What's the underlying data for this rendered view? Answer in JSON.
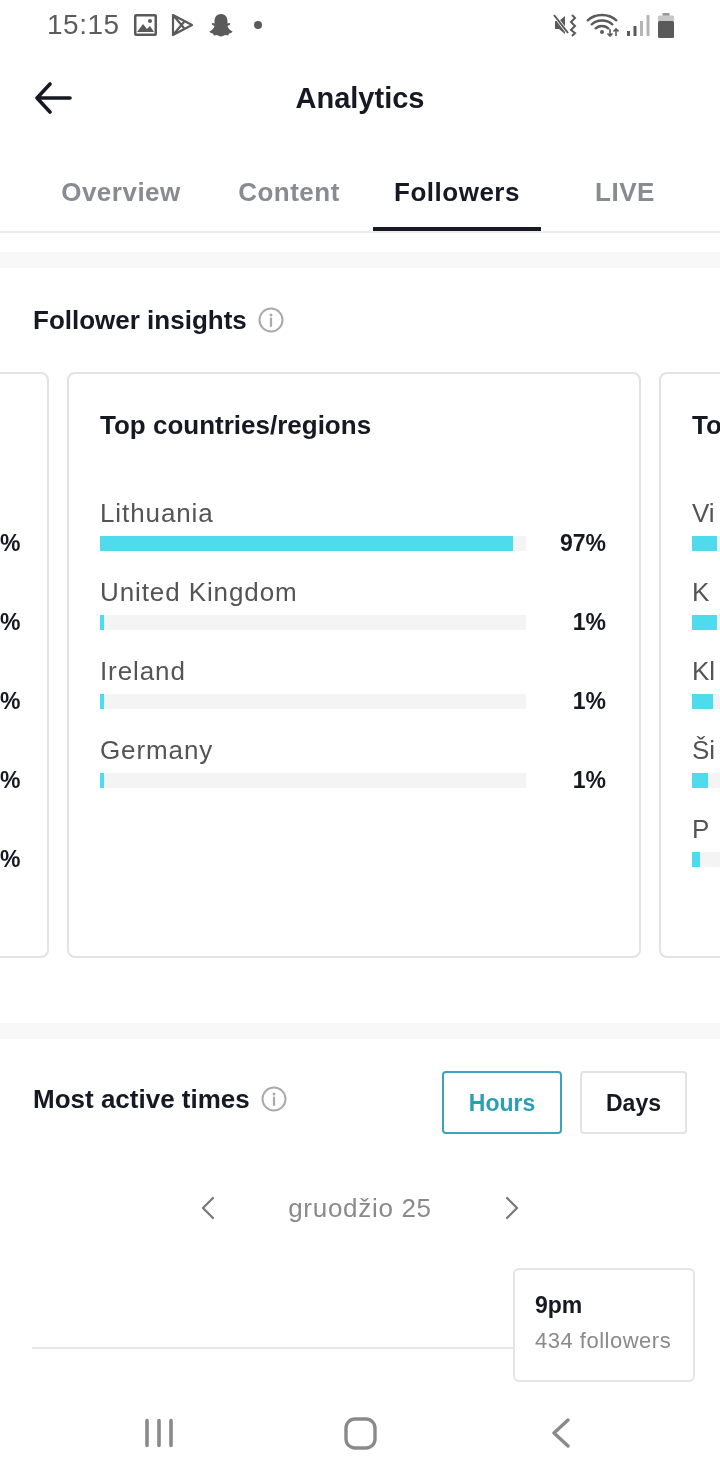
{
  "status_bar": {
    "time": "15:15"
  },
  "header": {
    "title": "Analytics"
  },
  "tabs": [
    {
      "label": "Overview",
      "selected": false
    },
    {
      "label": "Content",
      "selected": false
    },
    {
      "label": "Followers",
      "selected": true
    },
    {
      "label": "LIVE",
      "selected": false
    }
  ],
  "follower_insights": {
    "title": "Follower insights",
    "cards": [
      {
        "kind": "cut_left",
        "rows": [
          {
            "value": "%"
          },
          {
            "value": "%"
          },
          {
            "value": "%"
          },
          {
            "value": "%"
          },
          {
            "value": "%"
          }
        ]
      },
      {
        "kind": "full",
        "title": "Top countries/regions",
        "rows": [
          {
            "label": "Lithuania",
            "level": 0.97,
            "value": "97%"
          },
          {
            "label": "United Kingdom",
            "level": 0.01,
            "value": "1%"
          },
          {
            "label": "Ireland",
            "level": 0.01,
            "value": "1%"
          },
          {
            "label": "Germany",
            "level": 0.01,
            "value": "1%"
          }
        ]
      },
      {
        "kind": "cut_right",
        "title": "To",
        "rows": [
          {
            "label": "Vi",
            "level": 0.9
          },
          {
            "label": "K",
            "level": 0.9
          },
          {
            "label": "Kl",
            "level": 0.75
          },
          {
            "label": "Ši",
            "level": 0.57
          },
          {
            "label": "P",
            "level": 0.29
          }
        ]
      }
    ]
  },
  "most_active_times": {
    "title": "Most active times",
    "toggles": [
      {
        "label": "Hours",
        "selected": true
      },
      {
        "label": "Days",
        "selected": false
      }
    ],
    "date": "gruodžio 25",
    "tooltip": {
      "time": "9pm",
      "count": "434 followers"
    }
  }
}
